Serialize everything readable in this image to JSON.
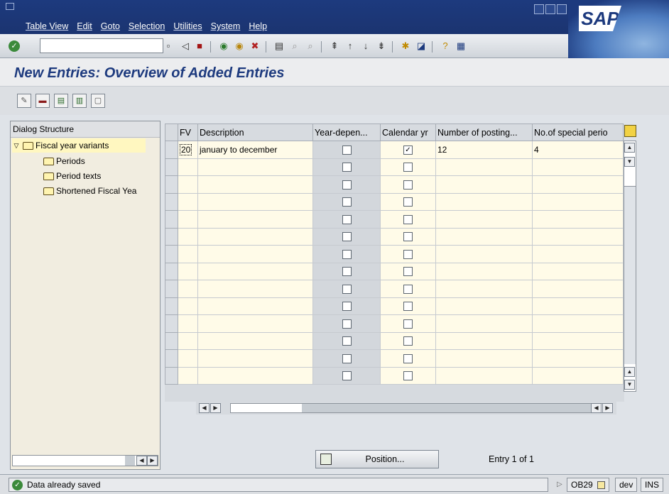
{
  "menubar": {
    "items": [
      "Table View",
      "Edit",
      "Goto",
      "Selection",
      "Utilities",
      "System",
      "Help"
    ]
  },
  "toolbar": {
    "ok_glyph": "✓"
  },
  "page": {
    "title": "New Entries: Overview of Added Entries"
  },
  "tree": {
    "header": "Dialog Structure",
    "root": "Fiscal year variants",
    "children": [
      "Periods",
      "Period texts",
      "Shortened Fiscal Yea"
    ]
  },
  "table": {
    "columns": [
      "FV",
      "Description",
      "Year-depen...",
      "Calendar yr",
      "Number of posting...",
      "No.of special perio"
    ],
    "rows": [
      {
        "fv": "20",
        "description": "january to december",
        "year_dependent": false,
        "calendar_year": true,
        "posting_periods": "12",
        "special_periods": "4"
      }
    ],
    "empty_rows": 13
  },
  "position": {
    "label": "Position..."
  },
  "entry": {
    "text": "Entry 1 of 1"
  },
  "status": {
    "message": "Data already saved",
    "transaction": "OB29",
    "system": "dev",
    "mode": "INS"
  }
}
